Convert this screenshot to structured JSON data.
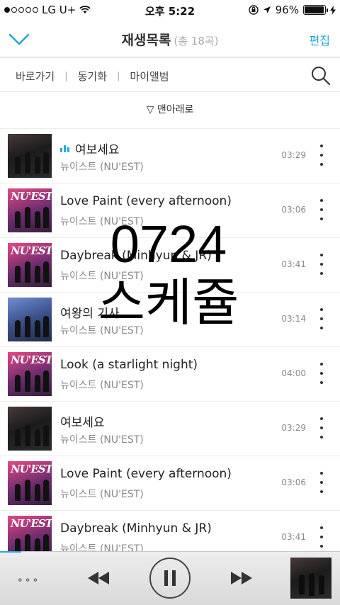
{
  "status_bar": {
    "carrier": "LG U+",
    "time": "오후 5:22",
    "battery": "96%",
    "battery_level": 0.96
  },
  "header": {
    "title": "재생목록",
    "count": "(총 18곡)",
    "edit_label": "편집"
  },
  "nav": {
    "items": [
      "바로가기",
      "동기화",
      "마이앨범"
    ],
    "separator": "|"
  },
  "scroll_bottom_label": "▽ 맨아래로",
  "playlist": [
    {
      "title": "여보세요",
      "artist": "뉴이스트 (NU'EST)",
      "duration": "03:29",
      "playing": true,
      "cover": "dark"
    },
    {
      "title": "Love Paint (every afternoon)",
      "artist": "뉴이스트 (NU'EST)",
      "duration": "03:06",
      "playing": false,
      "cover": "pink"
    },
    {
      "title": "Daybreak (Minhyun & JR)",
      "artist": "뉴이스트 (NU'EST)",
      "duration": "03:41",
      "playing": false,
      "cover": "pink"
    },
    {
      "title": "여왕의 기사",
      "artist": "뉴이스트 (NU'EST)",
      "duration": "03:14",
      "playing": false,
      "cover": "blue"
    },
    {
      "title": "Look (a starlight night)",
      "artist": "뉴이스트 (NU'EST)",
      "duration": "04:00",
      "playing": false,
      "cover": "pink"
    },
    {
      "title": "여보세요",
      "artist": "뉴이스트 (NU'EST)",
      "duration": "03:29",
      "playing": false,
      "cover": "dark"
    },
    {
      "title": "Love Paint (every afternoon)",
      "artist": "뉴이스트 (NU'EST)",
      "duration": "03:06",
      "playing": false,
      "cover": "pink"
    },
    {
      "title": "Daybreak (Minhyun & JR)",
      "artist": "뉴이스트 (NU'EST)",
      "duration": "03:41",
      "playing": false,
      "cover": "pink"
    }
  ],
  "album_logo_text": "NU'EST",
  "overlay": {
    "line1": "0724",
    "line2": "스케쥴"
  },
  "player": {
    "menu_label": "∘∘∘"
  },
  "colors": {
    "accent": "#1fa3d6",
    "text": "#222222",
    "subtext": "#888888"
  }
}
